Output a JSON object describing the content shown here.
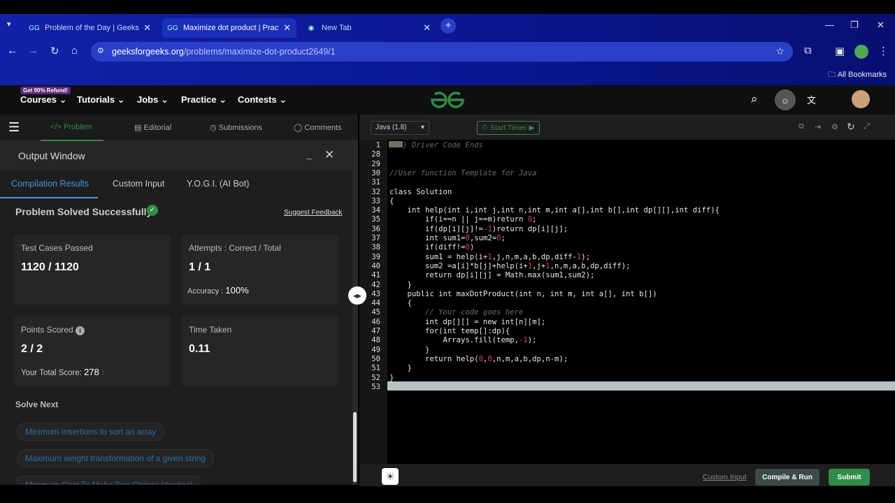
{
  "browser": {
    "tabs": [
      {
        "title": "Problem of the Day | GeeksforG",
        "favicon": "gfg-icon",
        "active": false
      },
      {
        "title": "Maximize dot product | Practice",
        "favicon": "gfg-icon",
        "active": true
      },
      {
        "title": "New Tab",
        "favicon": "chrome-icon",
        "active": false
      }
    ],
    "url_host": "geeksforgeeks.org",
    "url_path": "/problems/maximize-dot-product2649/1",
    "bookmarks_label": "All Bookmarks"
  },
  "site_nav": {
    "promo_badge": "Get 90% Refund!",
    "items": [
      "Courses",
      "Tutorials",
      "Jobs",
      "Practice",
      "Contests"
    ]
  },
  "problem_tabs": [
    "Problem",
    "Editorial",
    "Submissions",
    "Comments"
  ],
  "output": {
    "title": "Output Window",
    "tabs": [
      "Compilation Results",
      "Custom Input",
      "Y.O.G.I. (AI Bot)"
    ],
    "status": "Problem Solved Successfully",
    "suggest_feedback": "Suggest Feedback",
    "cards": {
      "tests_label": "Test Cases Passed",
      "tests_value": "1120 / 1120",
      "attempts_label": "Attempts : Correct / Total",
      "attempts_value": "1 / 1",
      "accuracy_label": "Accuracy :",
      "accuracy_value": "100%",
      "points_label": "Points Scored",
      "points_value": "2 / 2",
      "total_label": "Your Total Score:",
      "total_value": "278",
      "time_label": "Time Taken",
      "time_value": "0.11"
    },
    "solve_next_label": "Solve Next",
    "solve_next": [
      "Minimum insertions to sort an array",
      "Maximum weight transformation of a given string",
      "Minimum Cost To Make Two Strings Identical"
    ]
  },
  "editor": {
    "language": "Java (1.8)",
    "timer_label": "Start Timer",
    "custom_input": "Custom Input",
    "compile_run": "Compile & Run",
    "submit": "Submit",
    "lines": [
      {
        "n": "1",
        "html": "<span class='cmt'>// } Driver Code Ends</span>"
      },
      {
        "n": "28",
        "html": ""
      },
      {
        "n": "29",
        "html": ""
      },
      {
        "n": "30",
        "html": "<span class='cmt'>//User function Template for Java</span>"
      },
      {
        "n": "31",
        "html": ""
      },
      {
        "n": "32",
        "html": "class Solution"
      },
      {
        "n": "33",
        "html": "{"
      },
      {
        "n": "34",
        "html": "    int help(int i,int j,int n,int m,int a[],int b[],int dp[][],int diff){"
      },
      {
        "n": "35",
        "html": "        if(i==n || j==m)return <span class='num'>0</span>;"
      },
      {
        "n": "36",
        "html": "        if(dp[i][j]!=<span class='num'>-1</span>)return dp[i][j];"
      },
      {
        "n": "37",
        "html": "        int sum1=<span class='num'>0</span>,sum2=<span class='num'>0</span>;"
      },
      {
        "n": "38",
        "html": "        if(diff!=<span class='num'>0</span>)"
      },
      {
        "n": "39",
        "html": "        sum1 = help(i+<span class='num'>1</span>,j,n,m,a,b,dp,diff-<span class='num'>1</span>);"
      },
      {
        "n": "40",
        "html": "        sum2 =a[i]*b[j]+help(i+<span class='num'>1</span>,j+<span class='num'>1</span>,n,m,a,b,dp,diff);"
      },
      {
        "n": "41",
        "html": "        return dp[i][j] = Math.max(sum1,sum2);"
      },
      {
        "n": "42",
        "html": "    }"
      },
      {
        "n": "43",
        "html": "    public int maxDotProduct(int n, int m, int a[], int b[])"
      },
      {
        "n": "44",
        "html": "    {"
      },
      {
        "n": "45",
        "html": "        <span class='cmt'>// Your code goes here</span>"
      },
      {
        "n": "46",
        "html": "        int dp[][] = new int[n][m];"
      },
      {
        "n": "47",
        "html": "        for(int temp[]:dp){"
      },
      {
        "n": "48",
        "html": "            Arrays.fill(temp,<span class='num'>-1</span>);"
      },
      {
        "n": "49",
        "html": "        }"
      },
      {
        "n": "50",
        "html": "        return help(<span class='num'>0</span>,<span class='num'>0</span>,n,m,a,b,dp,n-m);"
      },
      {
        "n": "51",
        "html": "    }"
      },
      {
        "n": "52",
        "html": "}"
      },
      {
        "n": "53",
        "html": ""
      }
    ]
  },
  "colors": {
    "gfg_green": "#2f8d46",
    "link_blue": "#3a9ad9"
  }
}
